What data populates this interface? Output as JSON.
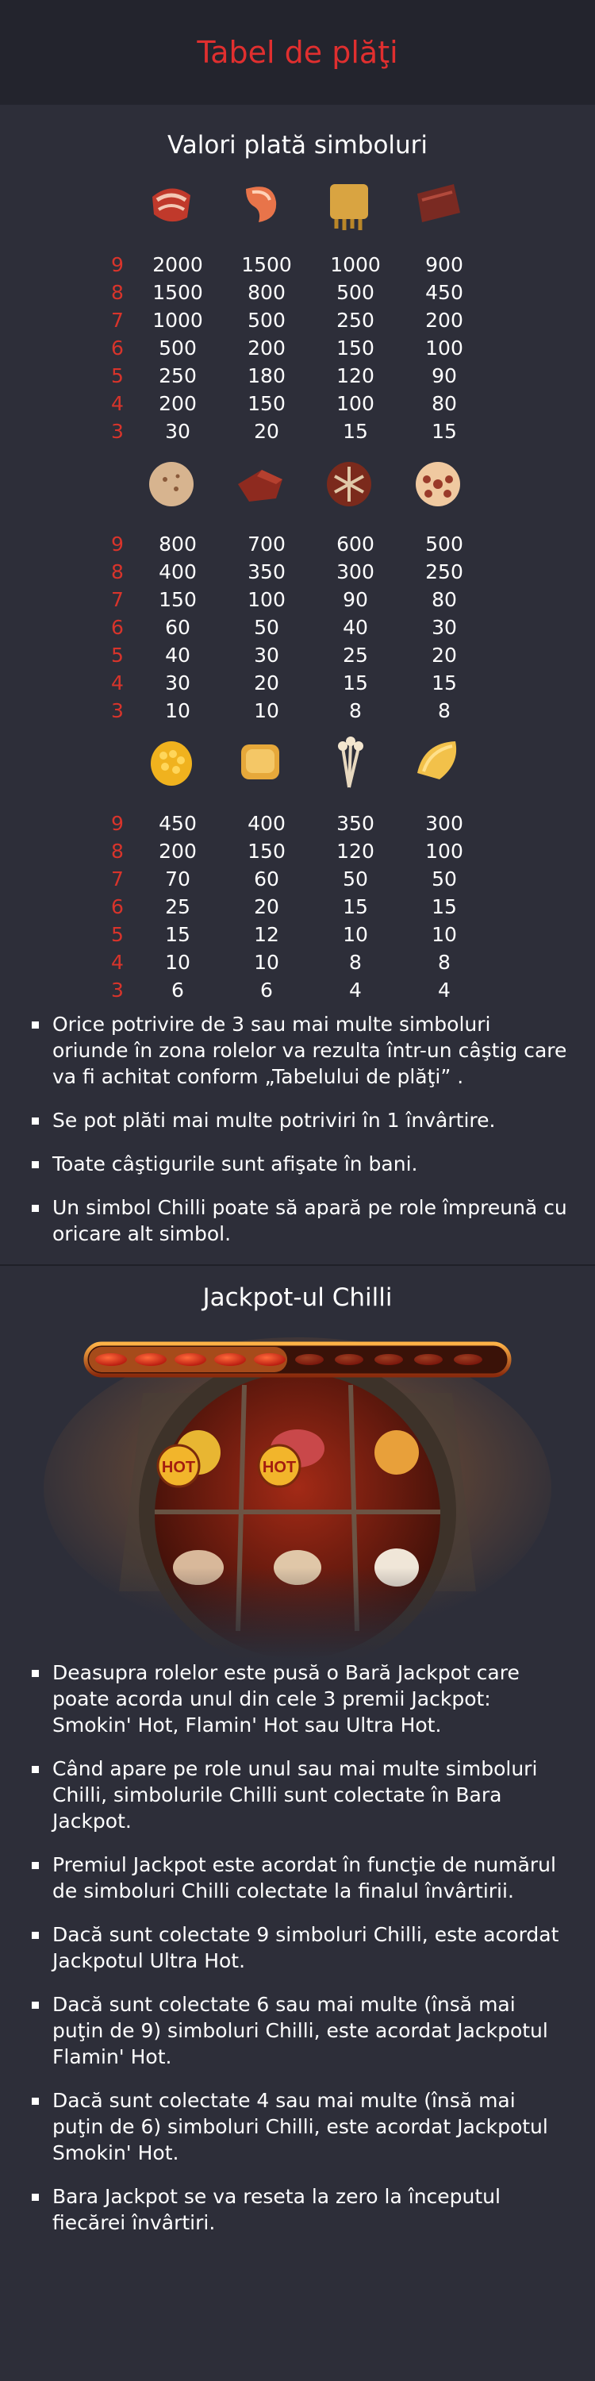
{
  "header": {
    "title": "Tabel de plăţi"
  },
  "paytable": {
    "title": "Valori plată simboluri",
    "row_labels": [
      "9",
      "8",
      "7",
      "6",
      "5",
      "4",
      "3"
    ],
    "groups": [
      {
        "symbols": [
          "bacon-icon",
          "shrimp-icon",
          "tripe-icon",
          "beef-slice-icon"
        ],
        "rows": [
          [
            "2000",
            "1500",
            "1000",
            "900"
          ],
          [
            "1500",
            "800",
            "500",
            "450"
          ],
          [
            "1000",
            "500",
            "250",
            "200"
          ],
          [
            "500",
            "200",
            "150",
            "100"
          ],
          [
            "250",
            "180",
            "120",
            "90"
          ],
          [
            "200",
            "150",
            "100",
            "80"
          ],
          [
            "30",
            "20",
            "15",
            "15"
          ]
        ]
      },
      {
        "symbols": [
          "meatball-icon",
          "duck-blood-icon",
          "mushroom-icon",
          "lotus-root-icon"
        ],
        "rows": [
          [
            "800",
            "700",
            "600",
            "500"
          ],
          [
            "400",
            "350",
            "300",
            "250"
          ],
          [
            "150",
            "100",
            "90",
            "80"
          ],
          [
            "60",
            "50",
            "40",
            "30"
          ],
          [
            "40",
            "30",
            "25",
            "20"
          ],
          [
            "30",
            "20",
            "15",
            "15"
          ],
          [
            "10",
            "10",
            "8",
            "8"
          ]
        ]
      },
      {
        "symbols": [
          "corn-icon",
          "tofu-icon",
          "enoki-icon",
          "potato-icon"
        ],
        "rows": [
          [
            "450",
            "400",
            "350",
            "300"
          ],
          [
            "200",
            "150",
            "120",
            "100"
          ],
          [
            "70",
            "60",
            "50",
            "50"
          ],
          [
            "25",
            "20",
            "15",
            "15"
          ],
          [
            "15",
            "12",
            "10",
            "10"
          ],
          [
            "10",
            "10",
            "8",
            "8"
          ],
          [
            "6",
            "6",
            "4",
            "4"
          ]
        ]
      }
    ]
  },
  "rules": [
    "Orice potrivire de 3 sau mai multe simboluri oriunde în zona rolelor va rezulta într-un câştig care va fi achitat conform „Tabelului de plăţi” .",
    "Se pot plăti mai multe potriviri în 1 învârtire.",
    "Toate câştigurile sunt afişate în bani.",
    "Un simbol Chilli poate să apară pe role împreună cu oricare alt simbol."
  ],
  "jackpot": {
    "title": "Jackpot-ul Chilli",
    "badges": [
      "HOT",
      "HOT"
    ],
    "rules": [
      "Deasupra rolelor este pusă o Bară Jackpot care poate acorda unul din cele 3 premii Jackpot: Smokin' Hot, Flamin' Hot sau Ultra Hot.",
      "Când apare pe role unul sau mai multe simboluri Chilli, simbolurile Chilli sunt colectate în Bara Jackpot.",
      "Premiul Jackpot este acordat în funcţie de numărul de simboluri Chilli colectate la finalul învârtirii.",
      "Dacă sunt colectate 9 simboluri Chilli, este acordat Jackpotul Ultra Hot.",
      "Dacă sunt colectate 6 sau mai multe (însă mai puţin de 9) simboluri Chilli, este acordat Jackpotul Flamin' Hot.",
      "Dacă sunt colectate 4 sau mai multe (însă mai puţin de 6) simboluri Chilli, este acordat Jackpotul Smokin' Hot.",
      "Bara Jackpot se va reseta la zero la începutul fiecărei învârtiri."
    ]
  },
  "colors": {
    "background": "#2d2e39",
    "header_background": "#23242d",
    "accent_red": "#e02f2f",
    "text": "#ffffff"
  }
}
